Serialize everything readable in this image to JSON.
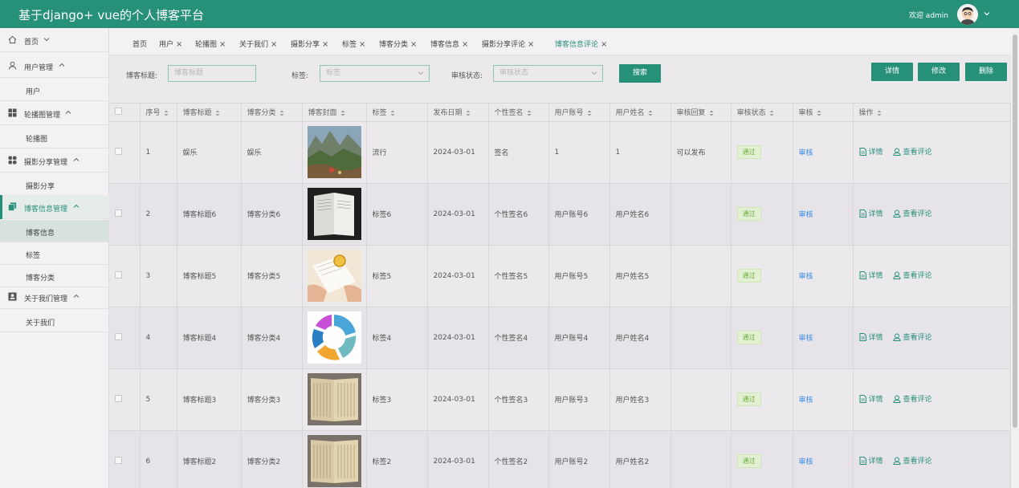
{
  "header": {
    "title": "基于django+ vue的个人博客平台",
    "welcome": "欢迎 admin"
  },
  "sidebar": {
    "items": [
      {
        "label": "首页",
        "icon": "home-icon"
      },
      {
        "label": "用户管理",
        "icon": "user-icon",
        "children": [
          "用户"
        ]
      },
      {
        "label": "轮播图管理",
        "icon": "grid-icon",
        "children": [
          "轮播图"
        ]
      },
      {
        "label": "摄影分享管理",
        "icon": "apps-icon",
        "children": [
          "摄影分享"
        ]
      },
      {
        "label": "博客信息管理",
        "icon": "copy-icon",
        "children": [
          "博客信息",
          "标签",
          "博客分类"
        ],
        "active": true
      },
      {
        "label": "关于我们管理",
        "icon": "contact-icon",
        "children": [
          "关于我们"
        ]
      }
    ]
  },
  "tabs": [
    "首页",
    "用户",
    "轮播图",
    "关于我们",
    "摄影分享",
    "标签",
    "博客分类",
    "博客信息",
    "摄影分享评论",
    "博客信息评论"
  ],
  "active_tab": "博客信息评论",
  "search": {
    "title_label": "博客标题:",
    "title_placeholder": "博客标题",
    "tag_label": "标签:",
    "tag_placeholder": "标签",
    "status_label": "审核状态:",
    "status_placeholder": "审核状态",
    "search_button": "搜索"
  },
  "actions": {
    "detail": "详情",
    "edit": "修改",
    "delete": "删除"
  },
  "table": {
    "columns": [
      "序号",
      "博客标题",
      "博客分类",
      "博客封面",
      "标签",
      "发布日期",
      "个性签名",
      "用户账号",
      "用户姓名",
      "审核回复",
      "审核状态",
      "审核",
      "操作"
    ],
    "rows": [
      {
        "no": "1",
        "title": "娱乐",
        "category": "娱乐",
        "cover": "landscape",
        "tag": "流行",
        "date": "2024-03-01",
        "signature": "签名",
        "account": "1",
        "name": "1",
        "reply": "可以发布",
        "status": "通过",
        "audit": "审核"
      },
      {
        "no": "2",
        "title": "博客标题6",
        "category": "博客分类6",
        "cover": "book-dark",
        "tag": "标签6",
        "date": "2024-03-01",
        "signature": "个性签名6",
        "account": "用户账号6",
        "name": "用户姓名6",
        "reply": "",
        "status": "通过",
        "audit": "审核"
      },
      {
        "no": "3",
        "title": "博客标题5",
        "category": "博客分类5",
        "cover": "reading",
        "tag": "标签5",
        "date": "2024-03-01",
        "signature": "个性签名5",
        "account": "用户账号5",
        "name": "用户姓名5",
        "reply": "",
        "status": "通过",
        "audit": "审核"
      },
      {
        "no": "4",
        "title": "博客标题4",
        "category": "博客分类4",
        "cover": "cycle",
        "tag": "标签4",
        "date": "2024-03-01",
        "signature": "个性签名4",
        "account": "用户账号4",
        "name": "用户姓名4",
        "reply": "",
        "status": "通过",
        "audit": "审核"
      },
      {
        "no": "5",
        "title": "博客标题3",
        "category": "博客分类3",
        "cover": "old-book",
        "tag": "标签3",
        "date": "2024-03-01",
        "signature": "个性签名3",
        "account": "用户账号3",
        "name": "用户姓名3",
        "reply": "",
        "status": "通过",
        "audit": "审核"
      },
      {
        "no": "6",
        "title": "博客标题2",
        "category": "博客分类2",
        "cover": "old-book",
        "tag": "标签2",
        "date": "2024-03-01",
        "signature": "个性签名2",
        "account": "用户账号2",
        "name": "用户姓名2",
        "reply": "",
        "status": "通过",
        "audit": "审核"
      }
    ],
    "row_ops": {
      "detail": "详情",
      "comments": "查看评论"
    }
  },
  "colors": {
    "brand": "#279079",
    "link": "#3a8ee6",
    "pass_tag": "#6cae3a"
  }
}
